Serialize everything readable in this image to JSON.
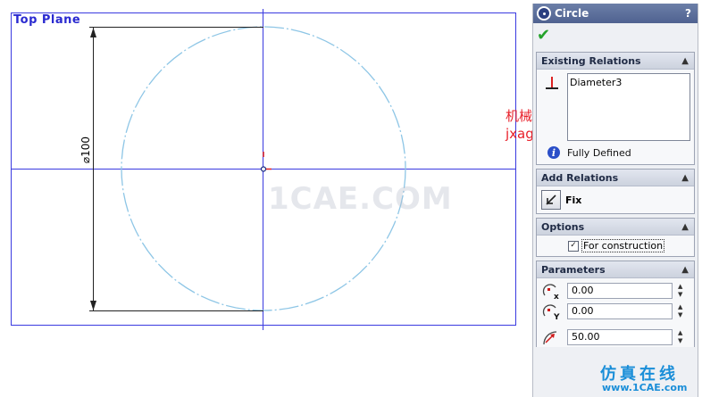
{
  "canvas": {
    "plane_label": "Top Plane",
    "dimension_label": "⌀100"
  },
  "panel": {
    "title": "Circle",
    "help": "?",
    "ok_icon": "check-icon",
    "existing_relations": {
      "header": "Existing Relations",
      "items": [
        "Diameter3"
      ],
      "status": "Fully Defined"
    },
    "add_relations": {
      "header": "Add Relations",
      "fix_label": "Fix"
    },
    "options": {
      "header": "Options",
      "for_construction_label": "For construction",
      "for_construction_checked": true
    },
    "parameters": {
      "header": "Parameters",
      "center_x": "0.00",
      "center_y": "0.00",
      "radius": "50.00"
    }
  },
  "watermarks": {
    "site_cn": "机械时代网",
    "site_url": "jxage.com",
    "center": "1CAE.COM",
    "bottom_cn": "仿真在线",
    "bottom_url": "www.1CAE.com"
  },
  "colors": {
    "plane_border": "#3a3ae0",
    "construction_circle": "#8ec6e6",
    "panel_title": "#4f6290",
    "ok_green": "#23a22a",
    "watermark_red": "#e8202a",
    "watermark_blue": "#1a8ed8"
  }
}
